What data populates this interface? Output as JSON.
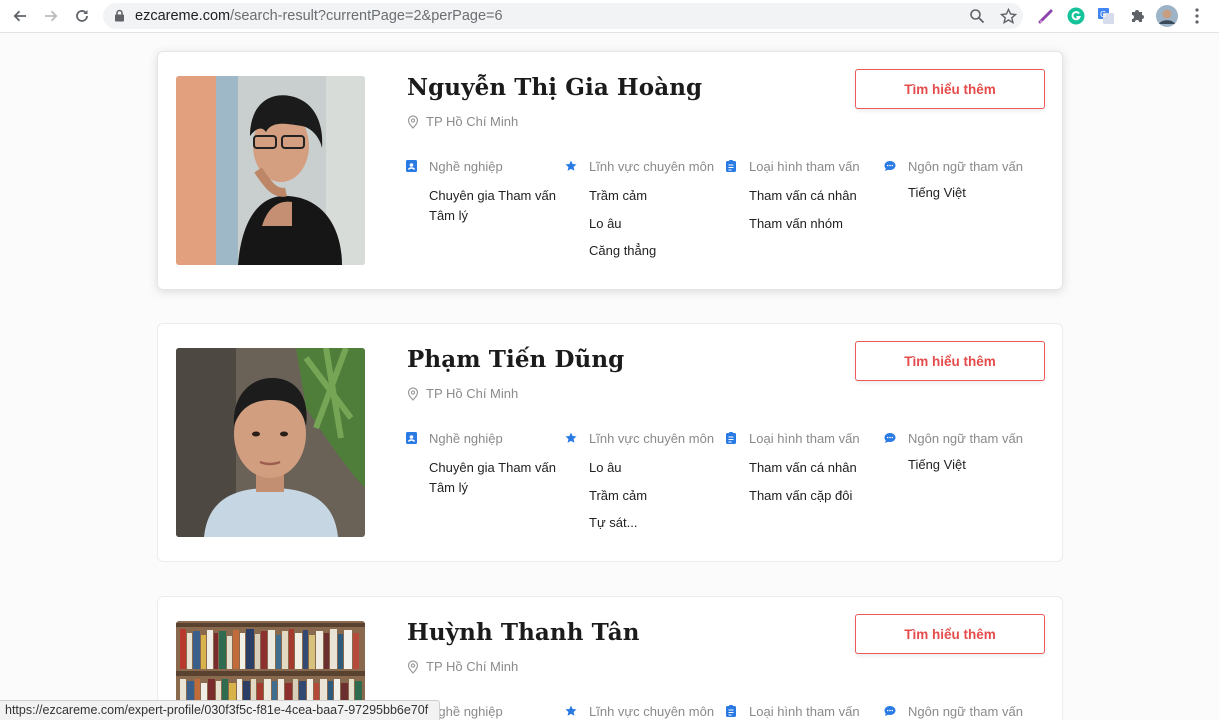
{
  "browser": {
    "url_host": "ezcareme.com",
    "url_path": "/search-result?currentPage=2&perPage=6"
  },
  "status_url": "https://ezcareme.com/expert-profile/030f3f5c-f81e-4cea-baa7-97295bb6e70f",
  "labels": {
    "occupation": "Nghề nghiệp",
    "field": "Lĩnh vực chuyên môn",
    "type": "Loại hình tham vấn",
    "language": "Ngôn ngữ tham vấn",
    "more_button": "Tìm hiểu thêm"
  },
  "experts": [
    {
      "name": "Nguyễn Thị Gia Hoàng",
      "location": "TP Hồ Chí Minh",
      "occupation": [
        "Chuyên gia Tham vấn",
        "Tâm lý"
      ],
      "fields": [
        "Trầm cảm",
        "Lo âu",
        "Căng thẳng"
      ],
      "types": [
        "Tham vấn cá nhân",
        "Tham vấn nhóm"
      ],
      "languages": [
        "Tiếng Việt"
      ]
    },
    {
      "name": "Phạm Tiến Dũng",
      "location": "TP Hồ Chí Minh",
      "occupation": [
        "Chuyên gia Tham vấn",
        "Tâm lý"
      ],
      "fields": [
        "Lo âu",
        "Trầm cảm",
        "Tự sát..."
      ],
      "types": [
        "Tham vấn cá nhân",
        "Tham vấn cặp đôi"
      ],
      "languages": [
        "Tiếng Việt"
      ]
    },
    {
      "name": "Huỳnh Thanh Tân",
      "location": "TP Hồ Chí Minh"
    }
  ]
}
